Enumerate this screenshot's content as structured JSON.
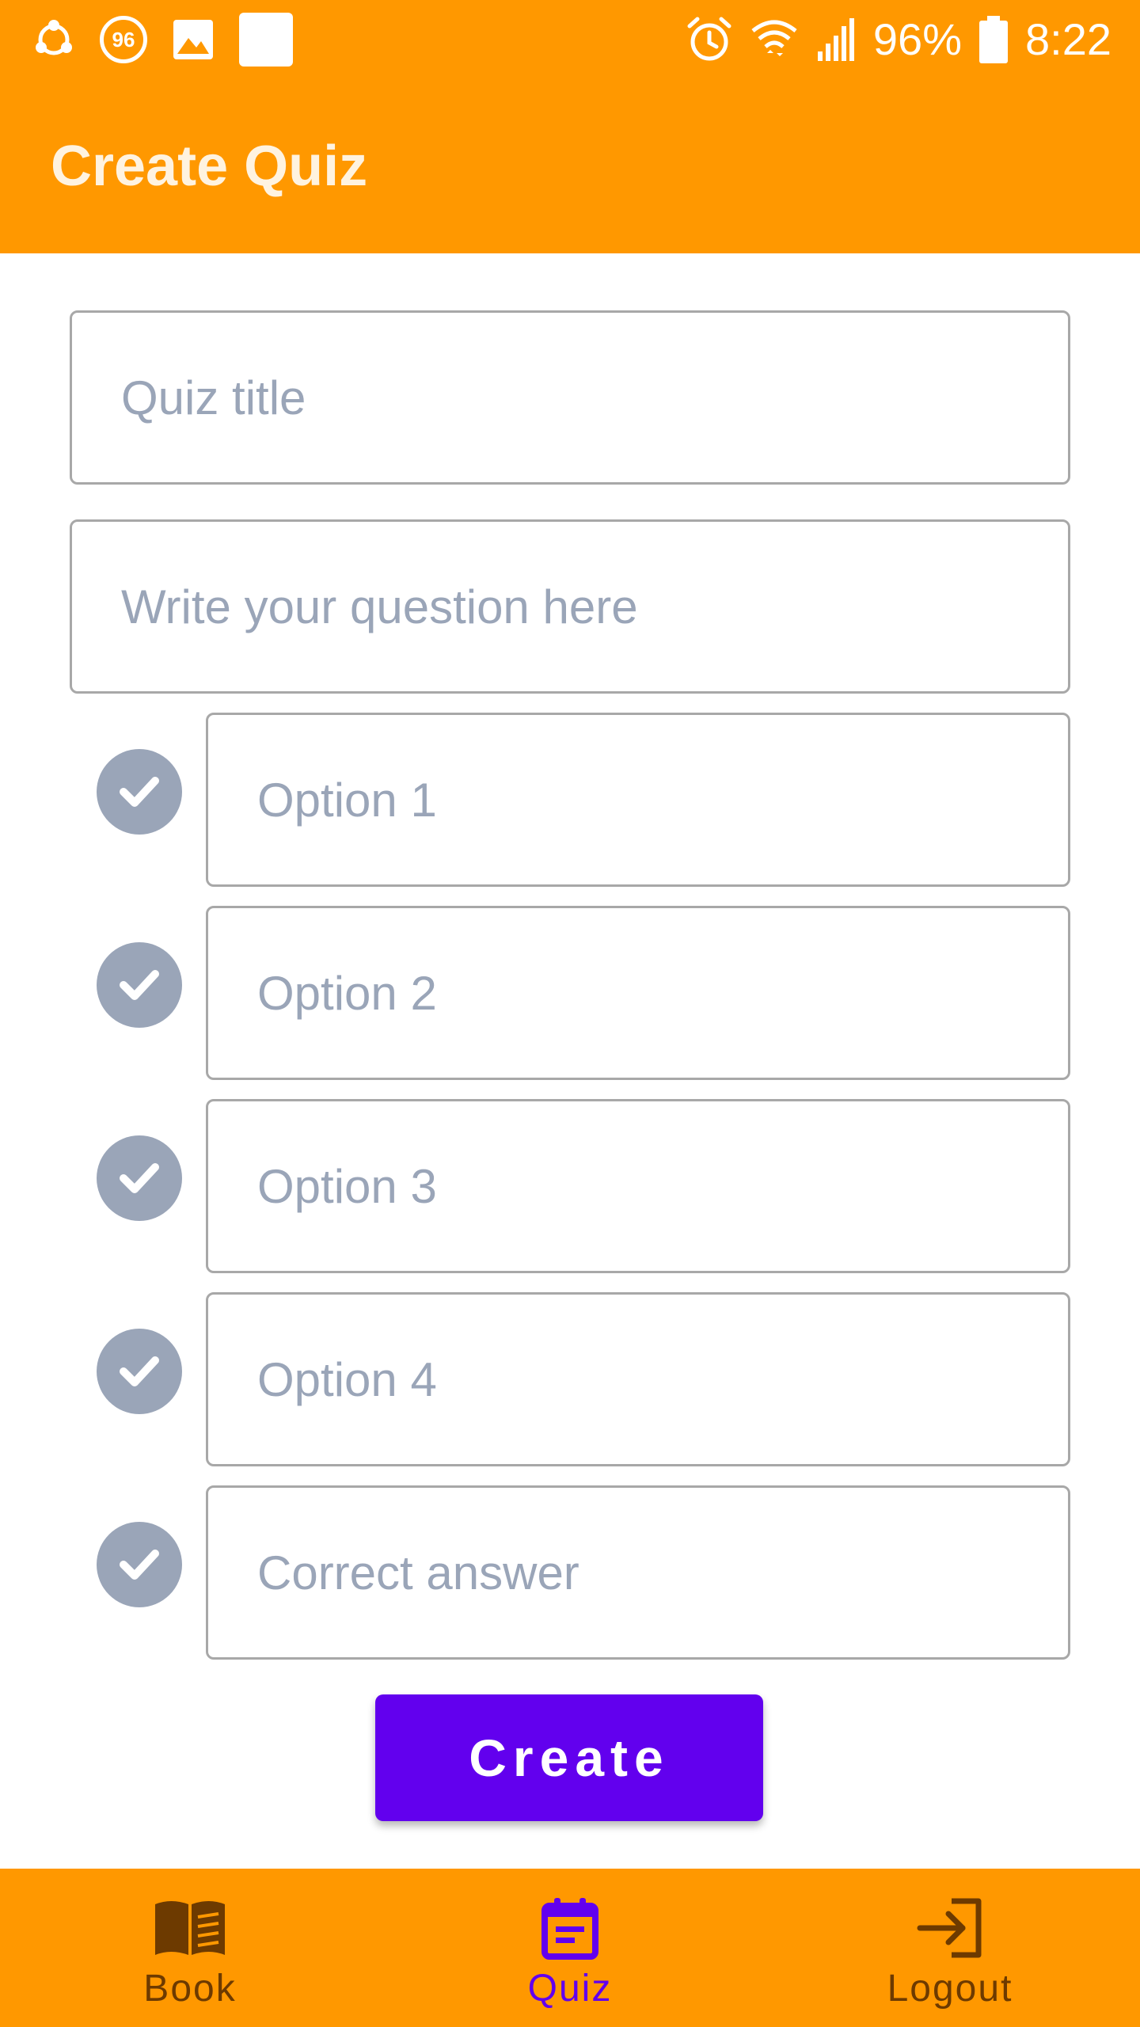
{
  "status_bar": {
    "badge_number": "96",
    "battery": "96%",
    "time": "8:22",
    "icons": [
      "sync-icon",
      "badge-96-icon",
      "image-icon",
      "white-square-icon",
      "alarm-icon",
      "wifi-icon",
      "signal-icon",
      "battery-icon"
    ]
  },
  "app_bar": {
    "title": "Create Quiz"
  },
  "form": {
    "quiz_title_placeholder": "Quiz title",
    "question_placeholder": "Write your question here",
    "options": [
      {
        "placeholder": "Option 1"
      },
      {
        "placeholder": "Option 2"
      },
      {
        "placeholder": "Option 3"
      },
      {
        "placeholder": "Option 4"
      },
      {
        "placeholder": "Correct answer"
      }
    ],
    "create_label": "Create"
  },
  "bottom_nav": {
    "items": [
      {
        "label": "Book",
        "icon": "book-icon",
        "active": false
      },
      {
        "label": "Quiz",
        "icon": "quiz-icon",
        "active": true
      },
      {
        "label": "Logout",
        "icon": "logout-icon",
        "active": false
      }
    ]
  },
  "colors": {
    "primary": "#FF9800",
    "accent": "#6200EE",
    "inactive_nav": "#6D3A00",
    "placeholder": "#9AA5B8",
    "title_text": "#FFF3E0"
  }
}
